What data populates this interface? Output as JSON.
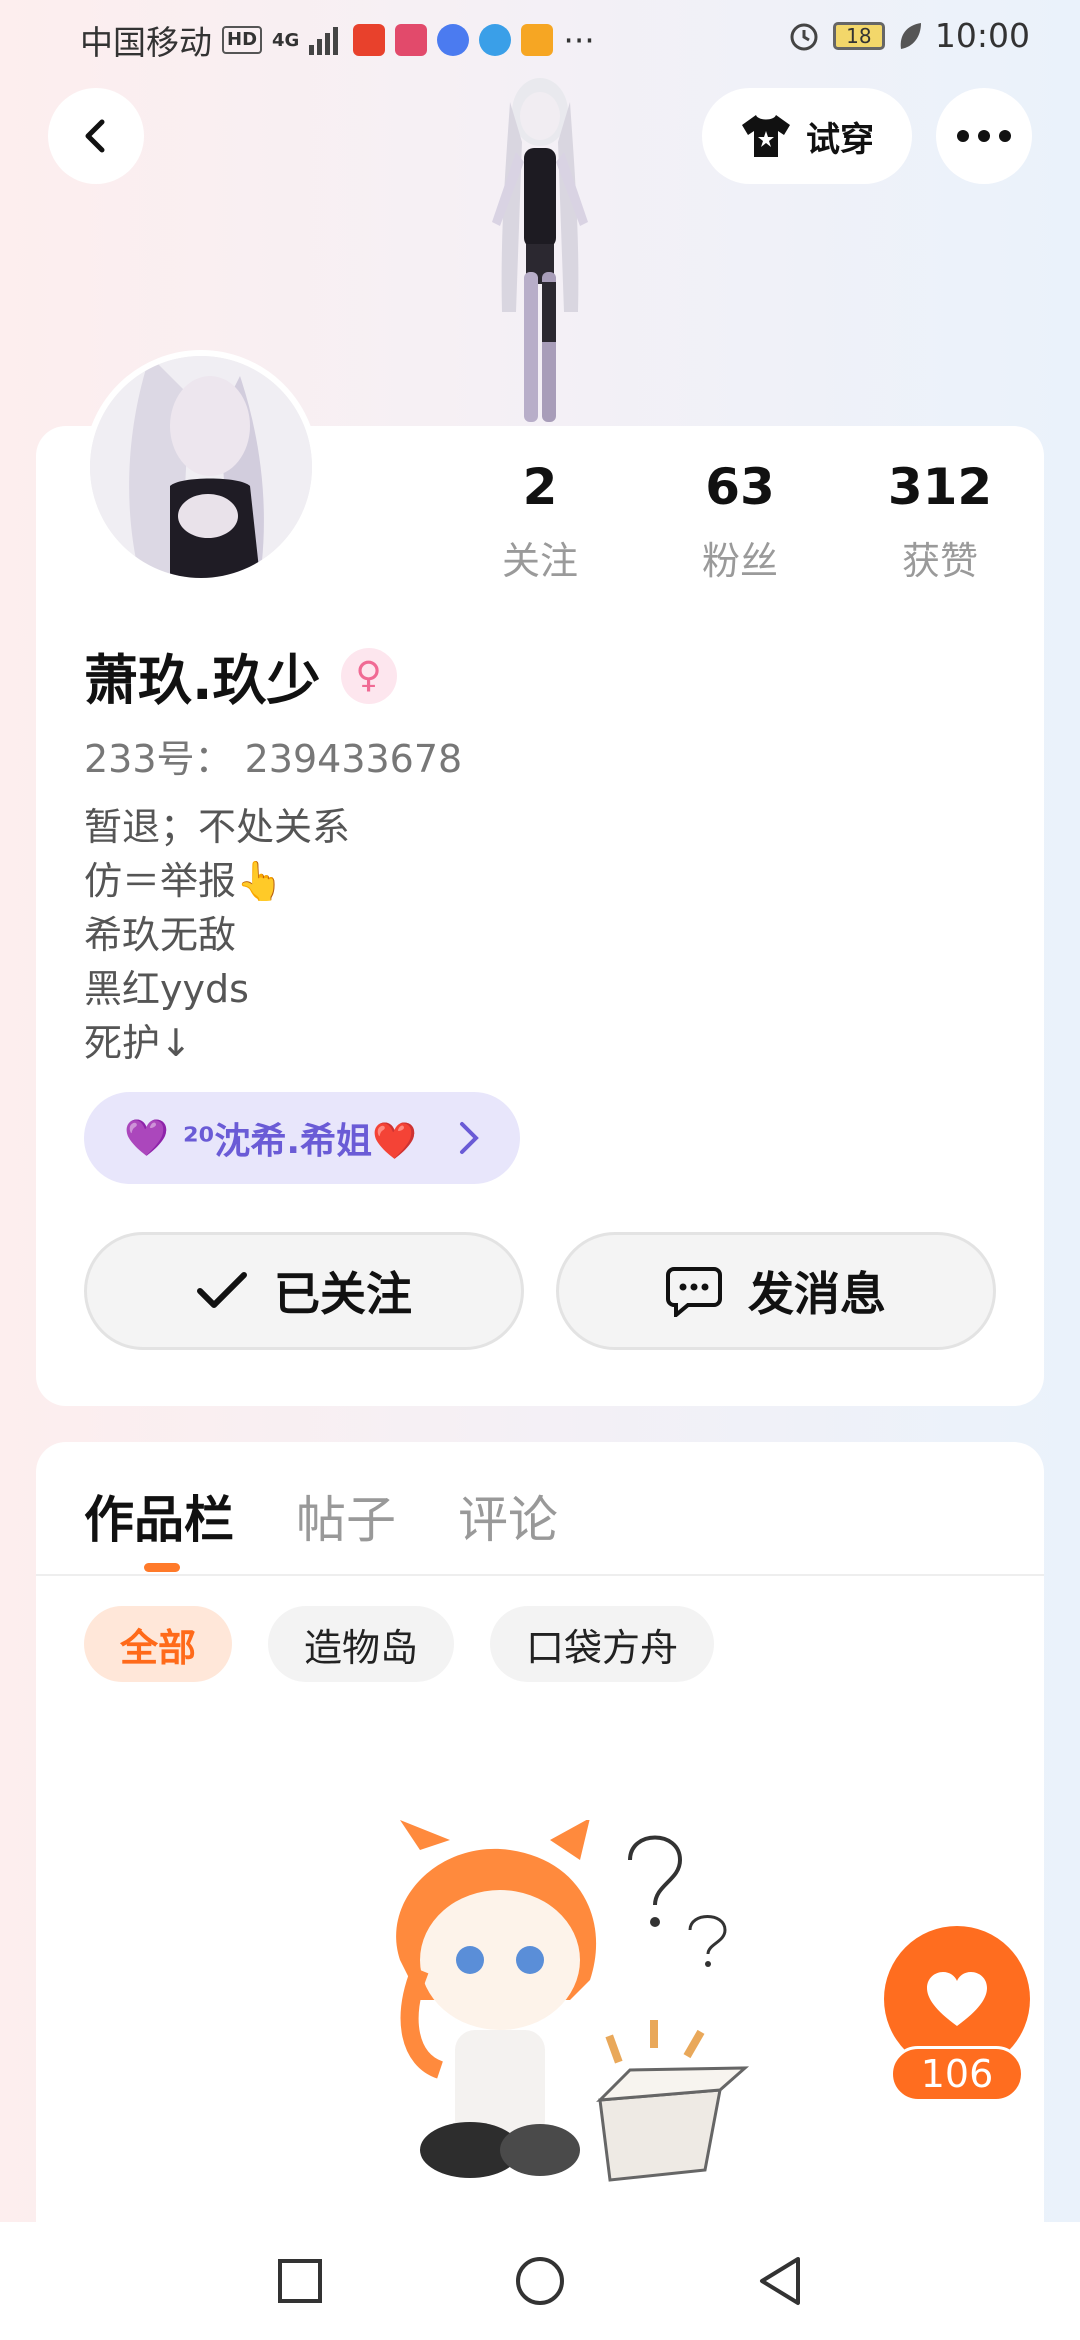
{
  "status_bar": {
    "carrier": "中国移动",
    "hd": "HD",
    "network": "4G",
    "battery": "18",
    "time": "10:00",
    "more": "···"
  },
  "header": {
    "tryon_label": "试穿"
  },
  "profile": {
    "stats": [
      {
        "value": "2",
        "label": "关注"
      },
      {
        "value": "63",
        "label": "粉丝"
      },
      {
        "value": "312",
        "label": "获赞"
      }
    ],
    "name": "萧玖.玖少",
    "gender_symbol": "♀",
    "uid": "233号： 239433678",
    "bio": [
      "暂退；不处关系",
      "仿＝举报👆",
      "希玖无敌",
      "黑红yyds",
      "死护↓"
    ],
    "club": {
      "heart": "💜",
      "label": "²⁰沈希.希姐❤️"
    }
  },
  "actions": {
    "follow_label": "已关注",
    "message_label": "发消息"
  },
  "tabs": [
    {
      "label": "作品栏",
      "active": true
    },
    {
      "label": "帖子",
      "active": false
    },
    {
      "label": "评论",
      "active": false
    }
  ],
  "filters": [
    {
      "label": "全部",
      "active": true
    },
    {
      "label": "造物岛",
      "active": false
    },
    {
      "label": "口袋方舟",
      "active": false
    }
  ],
  "like_fab": {
    "count": "106"
  },
  "colors": {
    "accent": "#ff6d1f",
    "club_text": "#6a5bd6",
    "gender": "#f06a94"
  }
}
